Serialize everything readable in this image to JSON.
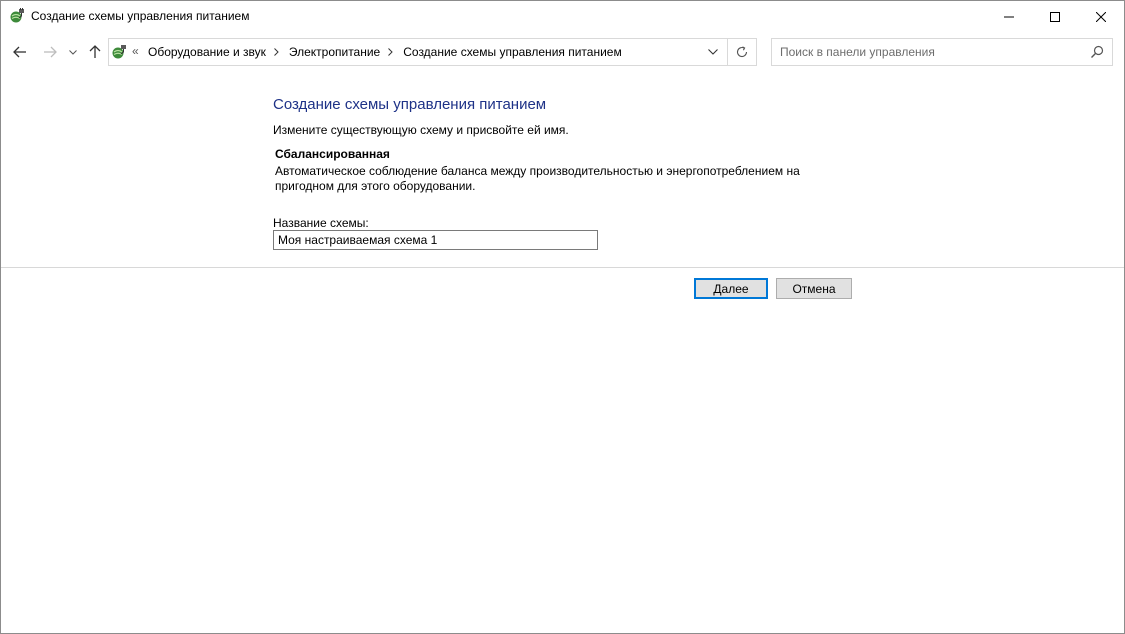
{
  "window": {
    "title": "Создание схемы управления питанием",
    "app_icon": "power-options-icon"
  },
  "navigation": {
    "address_overflow": "«",
    "breadcrumbs": [
      {
        "label": "Оборудование и звук"
      },
      {
        "label": "Электропитание"
      },
      {
        "label": "Создание схемы управления питанием"
      }
    ],
    "search_placeholder": "Поиск в панели управления"
  },
  "content": {
    "heading": "Создание схемы управления питанием",
    "instruction": "Измените существующую схему и присвойте ей имя.",
    "plan_name": "Сбалансированная",
    "plan_description": "Автоматическое соблюдение баланса между производительностью и энергопотреблением на пригодном для этого оборудовании.",
    "field_label": "Название схемы:",
    "field_value": "Моя настраиваемая схема 1"
  },
  "buttons": {
    "next": "Далее",
    "cancel": "Отмена"
  },
  "colors": {
    "heading": "#1e3287",
    "focus_border": "#0078d7",
    "button_face": "#e1e1e1"
  }
}
